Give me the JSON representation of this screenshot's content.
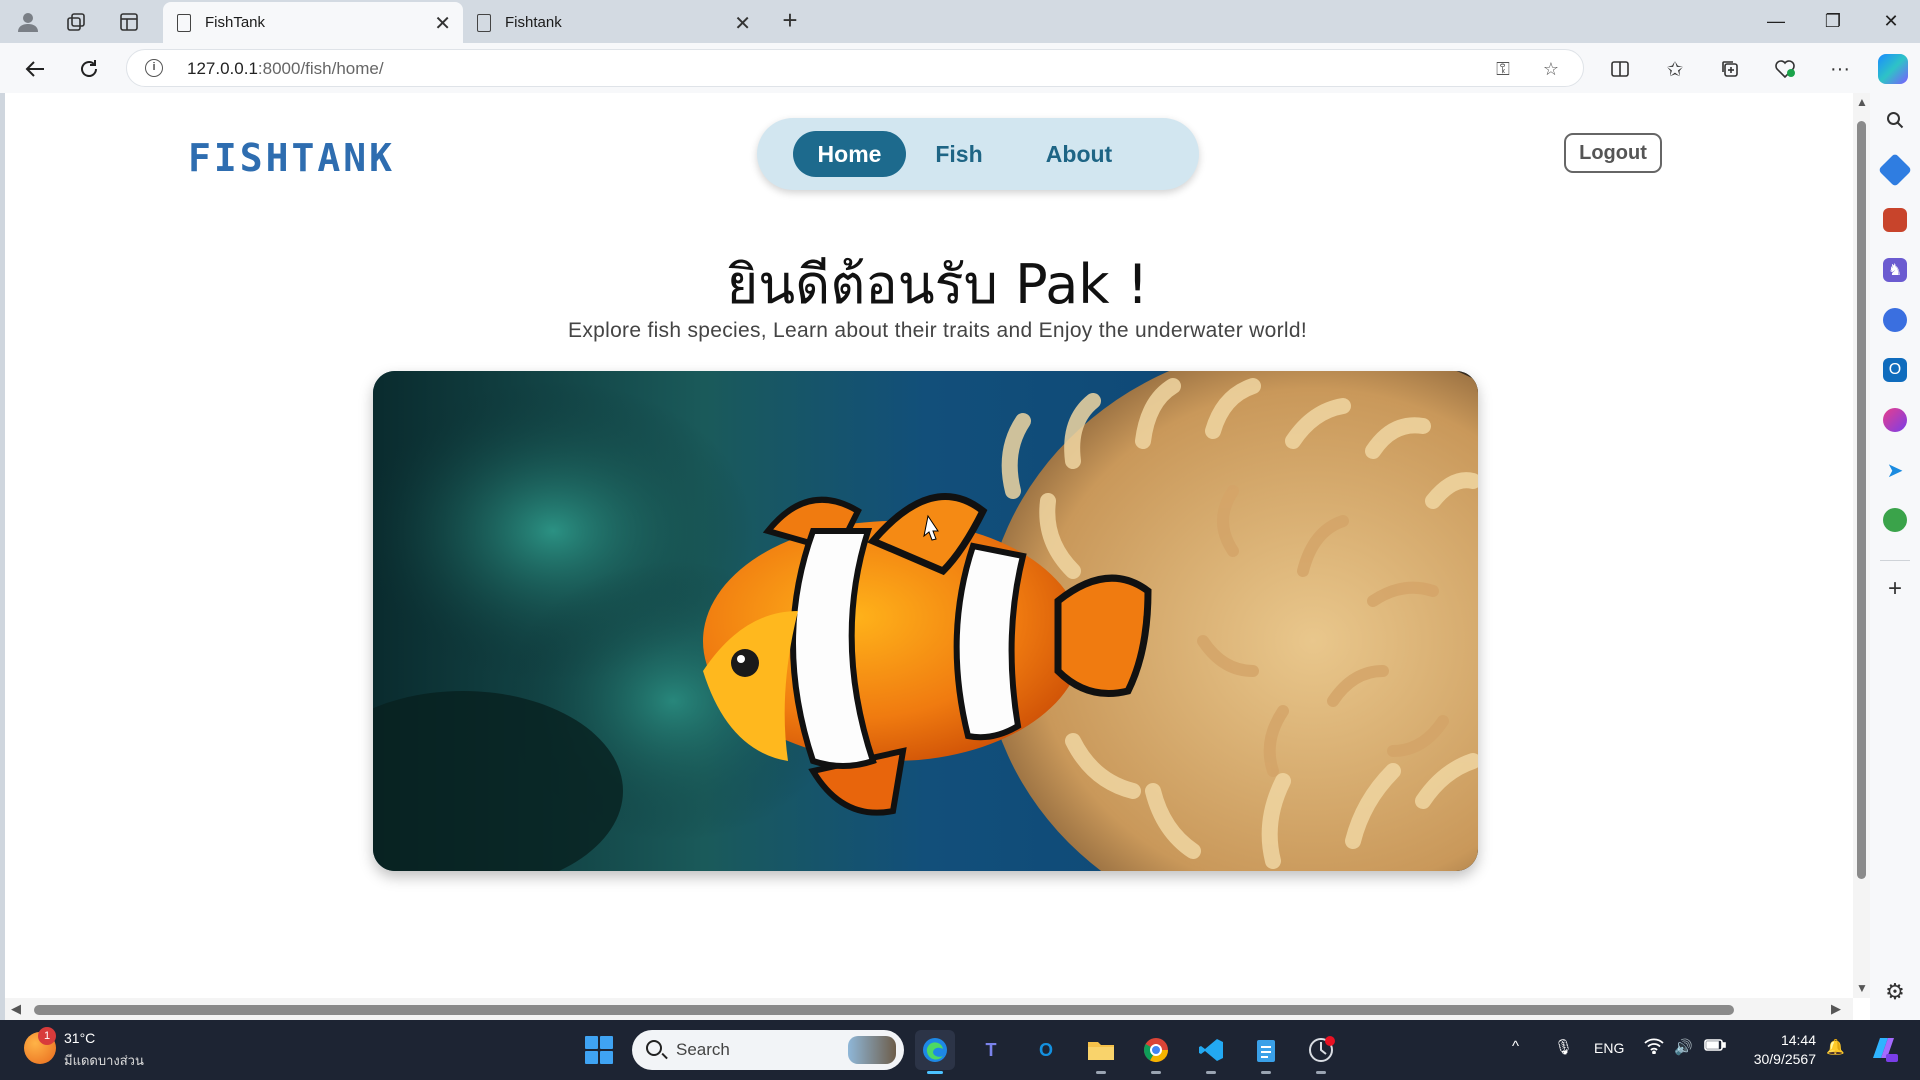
{
  "browser": {
    "tabs": [
      {
        "title": "FishTank",
        "active": true
      },
      {
        "title": "Fishtank",
        "active": false
      }
    ],
    "url_host": "127.0.0.1",
    "url_rest": ":8000/fish/home/",
    "new_tab_label": "+"
  },
  "site": {
    "logo": "FISHTANK",
    "nav": [
      {
        "label": "Home",
        "active": true
      },
      {
        "label": "Fish",
        "active": false
      },
      {
        "label": "About",
        "active": false
      }
    ],
    "logout_label": "Logout",
    "welcome": "ยินดีต้อนรับ Pak !",
    "subtitle": "Explore fish species, Learn about their traits and Enjoy the underwater world!",
    "hero_subject": "clownfish-in-anemone"
  },
  "sidebar": {
    "icons": [
      "search-icon",
      "tag-icon",
      "briefcase-icon",
      "chess-icon",
      "copilot-apps-icon",
      "outlook-icon",
      "drop-icon",
      "send-icon",
      "tree-icon",
      "add-icon",
      "settings-icon"
    ]
  },
  "taskbar": {
    "weather_badge": "1",
    "temperature": "31°C",
    "weather_desc": "มีแดดบางส่วน",
    "search_placeholder": "Search",
    "language": "ENG",
    "time": "14:44",
    "date": "30/9/2567"
  },
  "colors": {
    "nav_active_bg": "#1d6a8d",
    "nav_pill_bg": "#d2e6f0",
    "logo": "#2e6db0",
    "taskbar_bg": "#1d2433"
  }
}
